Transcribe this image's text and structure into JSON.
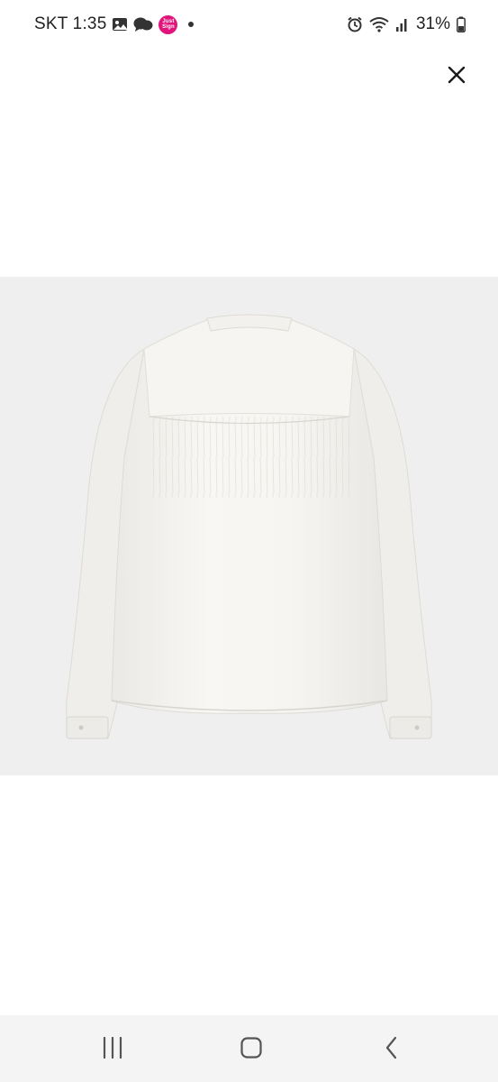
{
  "status_bar": {
    "carrier_time": "SKT 1:35",
    "app_badge_text": "Just Sign",
    "battery": "31%"
  },
  "viewer": {
    "close_icon": "close-icon",
    "image_description_icon": "blouse-image"
  },
  "nav": {
    "recents_icon": "recents-icon",
    "home_icon": "home-icon",
    "back_icon": "back-icon"
  }
}
